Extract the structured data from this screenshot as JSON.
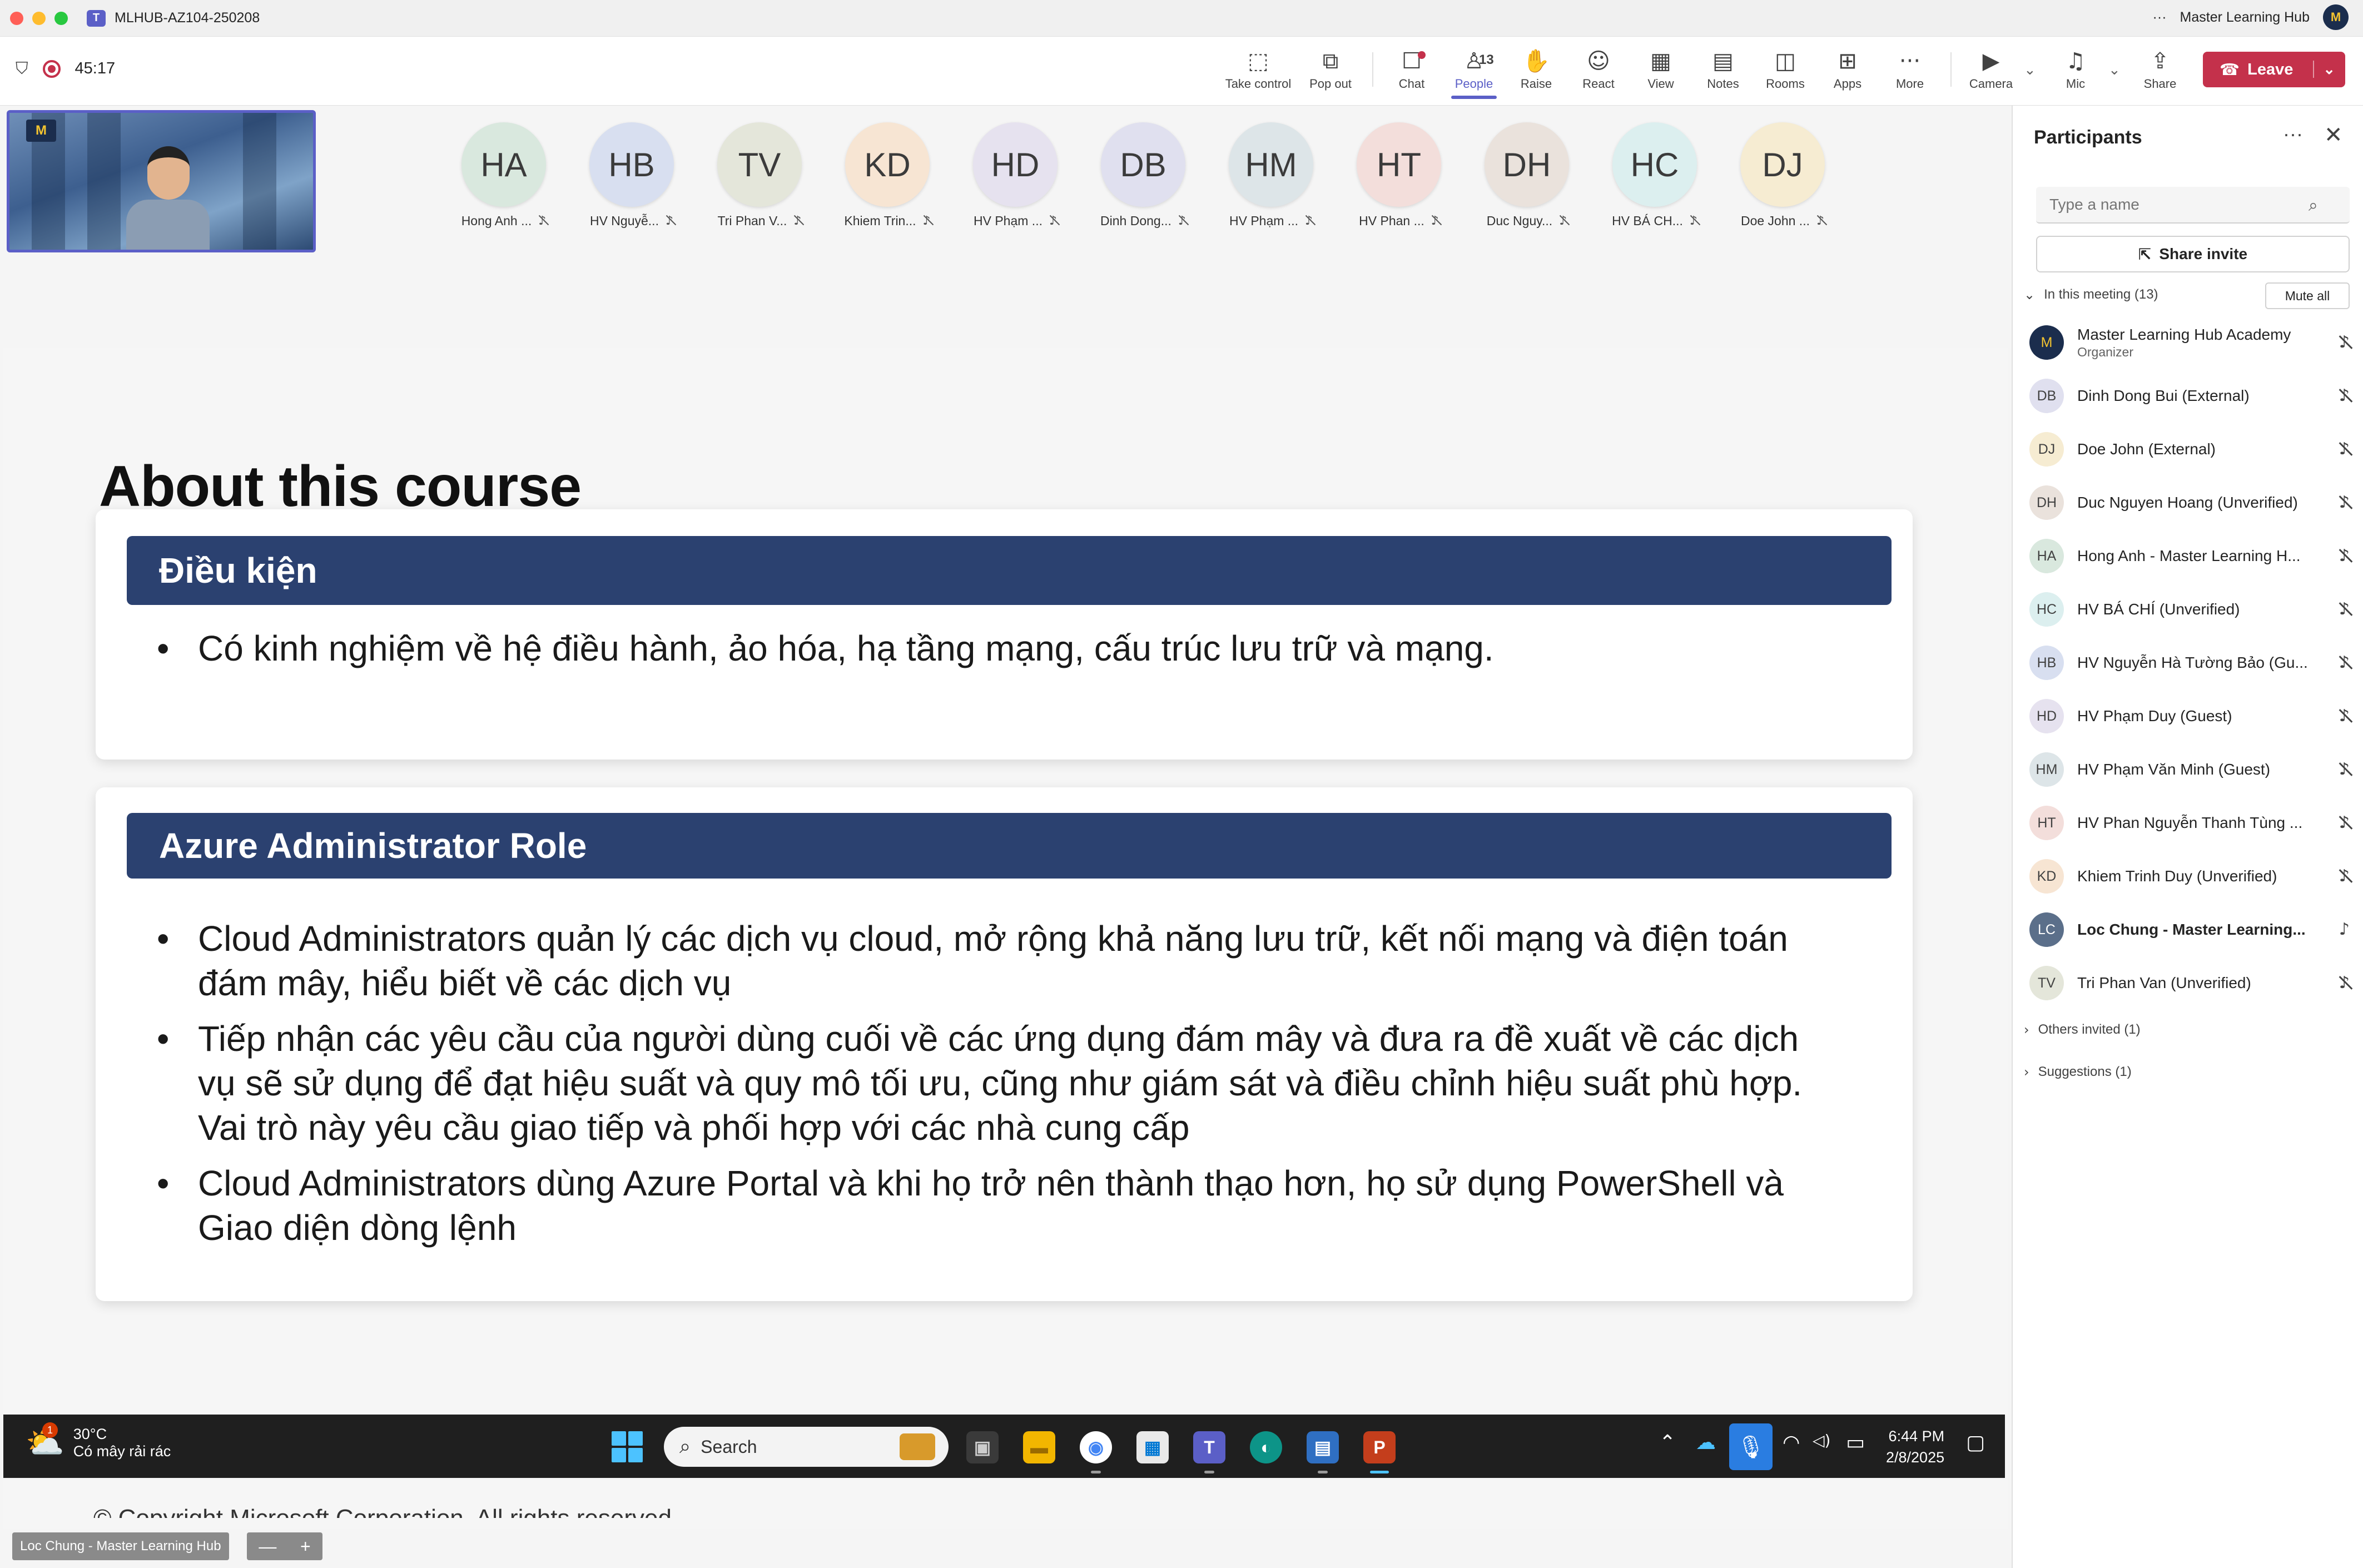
{
  "window": {
    "title": "MLHUB-AZ104-250208",
    "account_name": "Master Learning Hub",
    "more": "···",
    "logo_text": "T"
  },
  "meeting": {
    "timer": "45:17",
    "shield": "⛉"
  },
  "toolbar": {
    "take_control": "Take control",
    "pop_out": "Pop out",
    "chat": "Chat",
    "people": "People",
    "people_count": "13",
    "raise": "Raise",
    "react": "React",
    "view": "View",
    "notes": "Notes",
    "rooms": "Rooms",
    "apps": "Apps",
    "more": "More",
    "camera": "Camera",
    "mic": "Mic",
    "share": "Share",
    "leave": "Leave",
    "icons": {
      "take_control": "⬚",
      "pop_out": "⧉",
      "chat": "☐",
      "people": "♙",
      "raise": "✋",
      "react": "☺",
      "view": "▦",
      "notes": "▤",
      "rooms": "◫",
      "apps": "⊞",
      "more": "···",
      "camera": "▶",
      "mic": "♫",
      "share": "⇪",
      "leave": "☎",
      "caret": "⌄"
    }
  },
  "self_view": {
    "logo": "M"
  },
  "gallery": [
    {
      "initials": "HA",
      "name": "Hong Anh ...",
      "color": "#d9e8de"
    },
    {
      "initials": "HB",
      "name": "HV Nguyễ...",
      "color": "#d8dff0"
    },
    {
      "initials": "TV",
      "name": "Tri Phan V...",
      "color": "#e4e6da"
    },
    {
      "initials": "KD",
      "name": "Khiem Trin...",
      "color": "#f7e5d3"
    },
    {
      "initials": "HD",
      "name": "HV Phạm ...",
      "color": "#e6e2ef"
    },
    {
      "initials": "DB",
      "name": "Dinh Dong...",
      "color": "#e0e0ef"
    },
    {
      "initials": "HM",
      "name": "HV Phạm ...",
      "color": "#dde5e8"
    },
    {
      "initials": "HT",
      "name": "HV Phan ...",
      "color": "#f3dedb"
    },
    {
      "initials": "DH",
      "name": "Duc Nguy...",
      "color": "#eae2dc"
    },
    {
      "initials": "HC",
      "name": "HV BÁ CH...",
      "color": "#dcefef"
    },
    {
      "initials": "DJ",
      "name": "Doe John ...",
      "color": "#f6ecd2"
    }
  ],
  "slide": {
    "title": "About this course",
    "section1_heading": "Điều kiện",
    "section1_bullets": [
      "Có kinh nghiệm về hệ điều hành, ảo hóa, hạ tầng mạng, cấu trúc lưu trữ và mạng."
    ],
    "section2_heading": "Azure Administrator Role",
    "section2_bullets": [
      "Cloud Administrators quản lý các dịch vụ cloud, mở rộng khả năng lưu trữ, kết nối mạng và điện toán đám mây, hiểu biết về các dịch vụ",
      "Tiếp nhận các yêu cầu của người dùng cuối về các ứng dụng đám mây và đưa ra đề xuất về các dịch vụ sẽ sử dụng để đạt hiệu suất và quy mô tối ưu, cũng như giám sát và điều chỉnh hiệu suất phù hợp. Vai trò này yêu cầu giao tiếp và phối hợp với các nhà cung cấp",
      "Cloud Administrators dùng Azure Portal và khi họ trở nên thành thạo hơn, họ sử dụng PowerShell và Giao diện dòng lệnh"
    ],
    "copyright": "© Copyright Microsoft Corporation. All rights reserved."
  },
  "taskbar": {
    "weather_temp": "30°C",
    "weather_desc": "Có mây rải rác",
    "weather_badge": "1",
    "weather_icon": "⛅",
    "search_placeholder": "Search",
    "search_icon": "⌕",
    "time": "6:44 PM",
    "date": "2/8/2025",
    "apps": {
      "task_view": "▣",
      "explorer": "▬",
      "chrome": "◉",
      "store": "▦",
      "teams": "T",
      "edge": "◐",
      "notepad": "▤",
      "powerpoint": "P"
    },
    "tray": {
      "chevron": "⌃",
      "onedrive": "☁",
      "mic": "🎙",
      "wifi": "◠",
      "volume": "◁)",
      "battery": "▭",
      "notify": "▢"
    }
  },
  "video_label": {
    "name": "Loc Chung - Master Learning Hub",
    "zoom_out": "—",
    "zoom_in": "+"
  },
  "participants": {
    "title": "Participants",
    "more": "···",
    "close": "✕",
    "search_placeholder": "Type a name",
    "search_icon": "⌕",
    "share_invite": "Share invite",
    "share_icon": "⇱",
    "in_meeting": "In this meeting (13)",
    "mute_all": "Mute all",
    "others_invited": "Others invited (1)",
    "suggestions": "Suggestions (1)",
    "chevron_open": "⌄",
    "chevron_closed": "›",
    "mic_icon": "♪",
    "list": [
      {
        "initials": "M",
        "name": "Master Learning Hub Academy",
        "role": "Organizer",
        "color": "#1b2d4d",
        "text": "#f4c430",
        "muted": true,
        "bold": false
      },
      {
        "initials": "DB",
        "name": "Dinh Dong Bui (External)",
        "role": "",
        "color": "#e0e0ef",
        "text": "#424242",
        "muted": true,
        "bold": false
      },
      {
        "initials": "DJ",
        "name": "Doe John (External)",
        "role": "",
        "color": "#f6ecd2",
        "text": "#424242",
        "muted": true,
        "bold": false
      },
      {
        "initials": "DH",
        "name": "Duc Nguyen Hoang (Unverified)",
        "role": "",
        "color": "#eae2dc",
        "text": "#424242",
        "muted": true,
        "bold": false
      },
      {
        "initials": "HA",
        "name": "Hong Anh - Master Learning H...",
        "role": "",
        "color": "#d9e8de",
        "text": "#424242",
        "muted": true,
        "bold": false
      },
      {
        "initials": "HC",
        "name": "HV BÁ CHÍ (Unverified)",
        "role": "",
        "color": "#dcefef",
        "text": "#424242",
        "muted": true,
        "bold": false
      },
      {
        "initials": "HB",
        "name": "HV Nguyễn Hà Tường Bảo (Gu...",
        "role": "",
        "color": "#d8dff0",
        "text": "#424242",
        "muted": true,
        "bold": false
      },
      {
        "initials": "HD",
        "name": "HV Phạm Duy (Guest)",
        "role": "",
        "color": "#e6e2ef",
        "text": "#424242",
        "muted": true,
        "bold": false
      },
      {
        "initials": "HM",
        "name": "HV Phạm Văn Minh (Guest)",
        "role": "",
        "color": "#dde5e8",
        "text": "#424242",
        "muted": true,
        "bold": false
      },
      {
        "initials": "HT",
        "name": "HV Phan Nguyễn Thanh Tùng ...",
        "role": "",
        "color": "#f3dedb",
        "text": "#424242",
        "muted": true,
        "bold": false
      },
      {
        "initials": "KD",
        "name": "Khiem Trinh Duy (Unverified)",
        "role": "",
        "color": "#f7e5d3",
        "text": "#424242",
        "muted": true,
        "bold": false
      },
      {
        "initials": "LC",
        "name": "Loc Chung - Master Learning...",
        "role": "",
        "color": "#5b6f8a",
        "text": "#ffffff",
        "muted": false,
        "bold": true
      },
      {
        "initials": "TV",
        "name": "Tri Phan Van (Unverified)",
        "role": "",
        "color": "#e4e6da",
        "text": "#424242",
        "muted": true,
        "bold": false
      }
    ]
  }
}
